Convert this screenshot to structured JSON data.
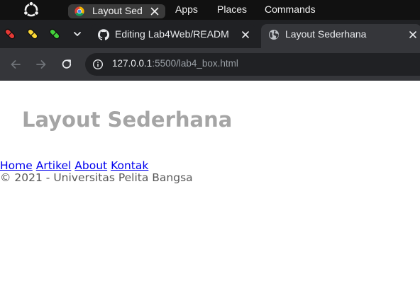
{
  "os_panel": {
    "logo_icon": "ubuntu-logo-icon",
    "app_indicator": {
      "icon": "chrome-logo-icon",
      "title": "Layout Sed"
    },
    "menus": [
      "Apps",
      "Places",
      "Commands"
    ]
  },
  "browser": {
    "extensions": [
      "pill-red-icon",
      "pill-yellow-icon",
      "pill-green-icon"
    ],
    "tabs": [
      {
        "title": "Editing Lab4Web/READM",
        "icon": "github-icon",
        "active": false
      },
      {
        "title": "Layout Sederhana",
        "icon": "globe-icon",
        "active": true
      }
    ],
    "address_bar": {
      "url_host": "127.0.0.1",
      "url_rest": ":5500/lab4_box.html"
    }
  },
  "page": {
    "heading": "Layout Sederhana",
    "nav": [
      "Home",
      "Artikel",
      "About",
      "Kontak"
    ],
    "footer": "© 2021 - Universitas Pelita Bangsa"
  },
  "colors": {
    "os_panel": "#111111",
    "tabstrip": "#202124",
    "toolbar": "#35363a",
    "heading": "#a5a5a5",
    "link": "#0000ee",
    "footer_text": "#595959"
  }
}
